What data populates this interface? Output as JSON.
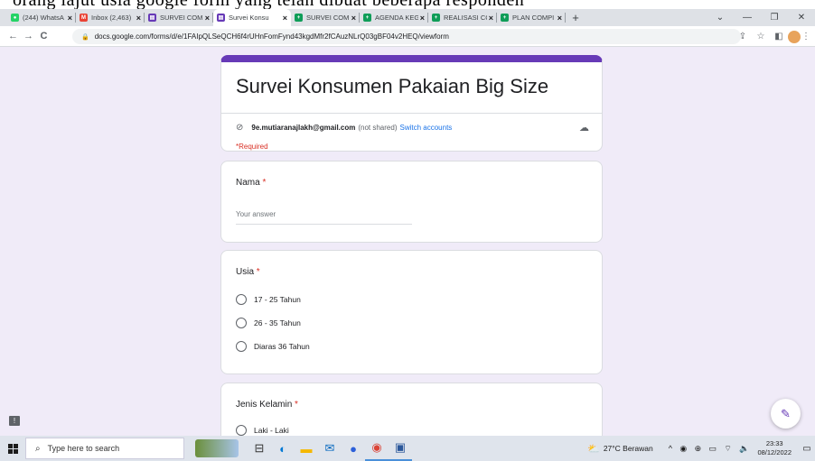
{
  "top_text": "orang lajut usia google form yang telah dibuat beberapa responden",
  "browser": {
    "tabs": [
      {
        "label": "(244) WhatsA",
        "color": "#25d366",
        "glyph": "●"
      },
      {
        "label": "Inbox (2,463)",
        "color": "#ea4335",
        "glyph": "M"
      },
      {
        "label": "SURVEI COM",
        "color": "#673ab7",
        "glyph": "▤"
      },
      {
        "label": "Survei Konsu",
        "color": "#673ab7",
        "glyph": "▤",
        "active": true
      },
      {
        "label": "SURVEI COM",
        "color": "#0f9d58",
        "glyph": "+"
      },
      {
        "label": "AGENDA KEG",
        "color": "#0f9d58",
        "glyph": "+"
      },
      {
        "label": "REALISASI CC",
        "color": "#0f9d58",
        "glyph": "+"
      },
      {
        "label": "PLAN COMPI",
        "color": "#0f9d58",
        "glyph": "+"
      }
    ],
    "url": "docs.google.com/forms/d/e/1FAIpQLSeQCH6f4rUHnFomFynd43kgdMfr2fCAuzNLrQ03gBF04v2HEQ/viewform"
  },
  "form": {
    "title": "Survei Konsumen Pakaian Big Size",
    "account_email": "9e.mutiaranajlakh@gmail.com",
    "account_note": "(not shared)",
    "switch_label": "Switch accounts",
    "required_note": "*Required",
    "questions": [
      {
        "title": "Nama",
        "required_mark": "*",
        "placeholder": "Your answer"
      },
      {
        "title": "Usia",
        "required_mark": "*",
        "options": [
          "17 - 25 Tahun",
          "26 - 35 Tahun",
          "Diaras 36 Tahun"
        ]
      },
      {
        "title": "Jenis Kelamin",
        "required_mark": "*",
        "options": [
          "Laki - Laki"
        ]
      }
    ]
  },
  "taskbar": {
    "search_placeholder": "Type here to search",
    "weather": "27°C  Berawan",
    "time": "23:33",
    "date": "08/12/2022"
  }
}
